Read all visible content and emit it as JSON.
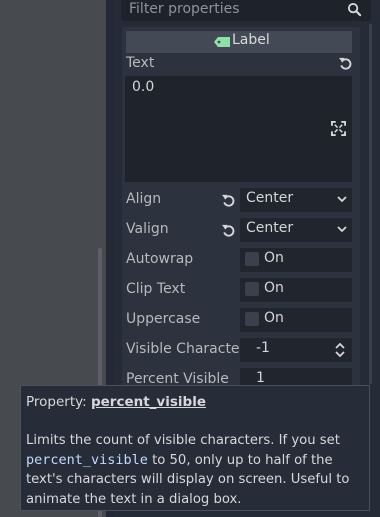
{
  "filter": {
    "placeholder": "Filter properties"
  },
  "section": {
    "title": "Label"
  },
  "text_prop": {
    "label": "Text",
    "value": "0.0"
  },
  "properties": [
    {
      "name": "Align",
      "value": "Center"
    },
    {
      "name": "Valign",
      "value": "Center"
    },
    {
      "name": "Autowrap",
      "value": "On"
    },
    {
      "name": "Clip Text",
      "value": "On"
    },
    {
      "name": "Uppercase",
      "value": "On"
    },
    {
      "name": "Visible Character",
      "value": "-1"
    },
    {
      "name": "Percent Visible",
      "value": "1"
    }
  ],
  "tooltip": {
    "prefix": "Property: ",
    "name": "percent_visible",
    "desc_1": "Limits the count of visible characters. If you set",
    "desc_code": "percent_visible",
    "desc_2": " to 50, only up to half of the text's characters will display on screen. Useful to animate the text in a dialog box."
  },
  "colors": {
    "accent_tag": "#8ee0a8",
    "code": "#c3d9ff"
  }
}
